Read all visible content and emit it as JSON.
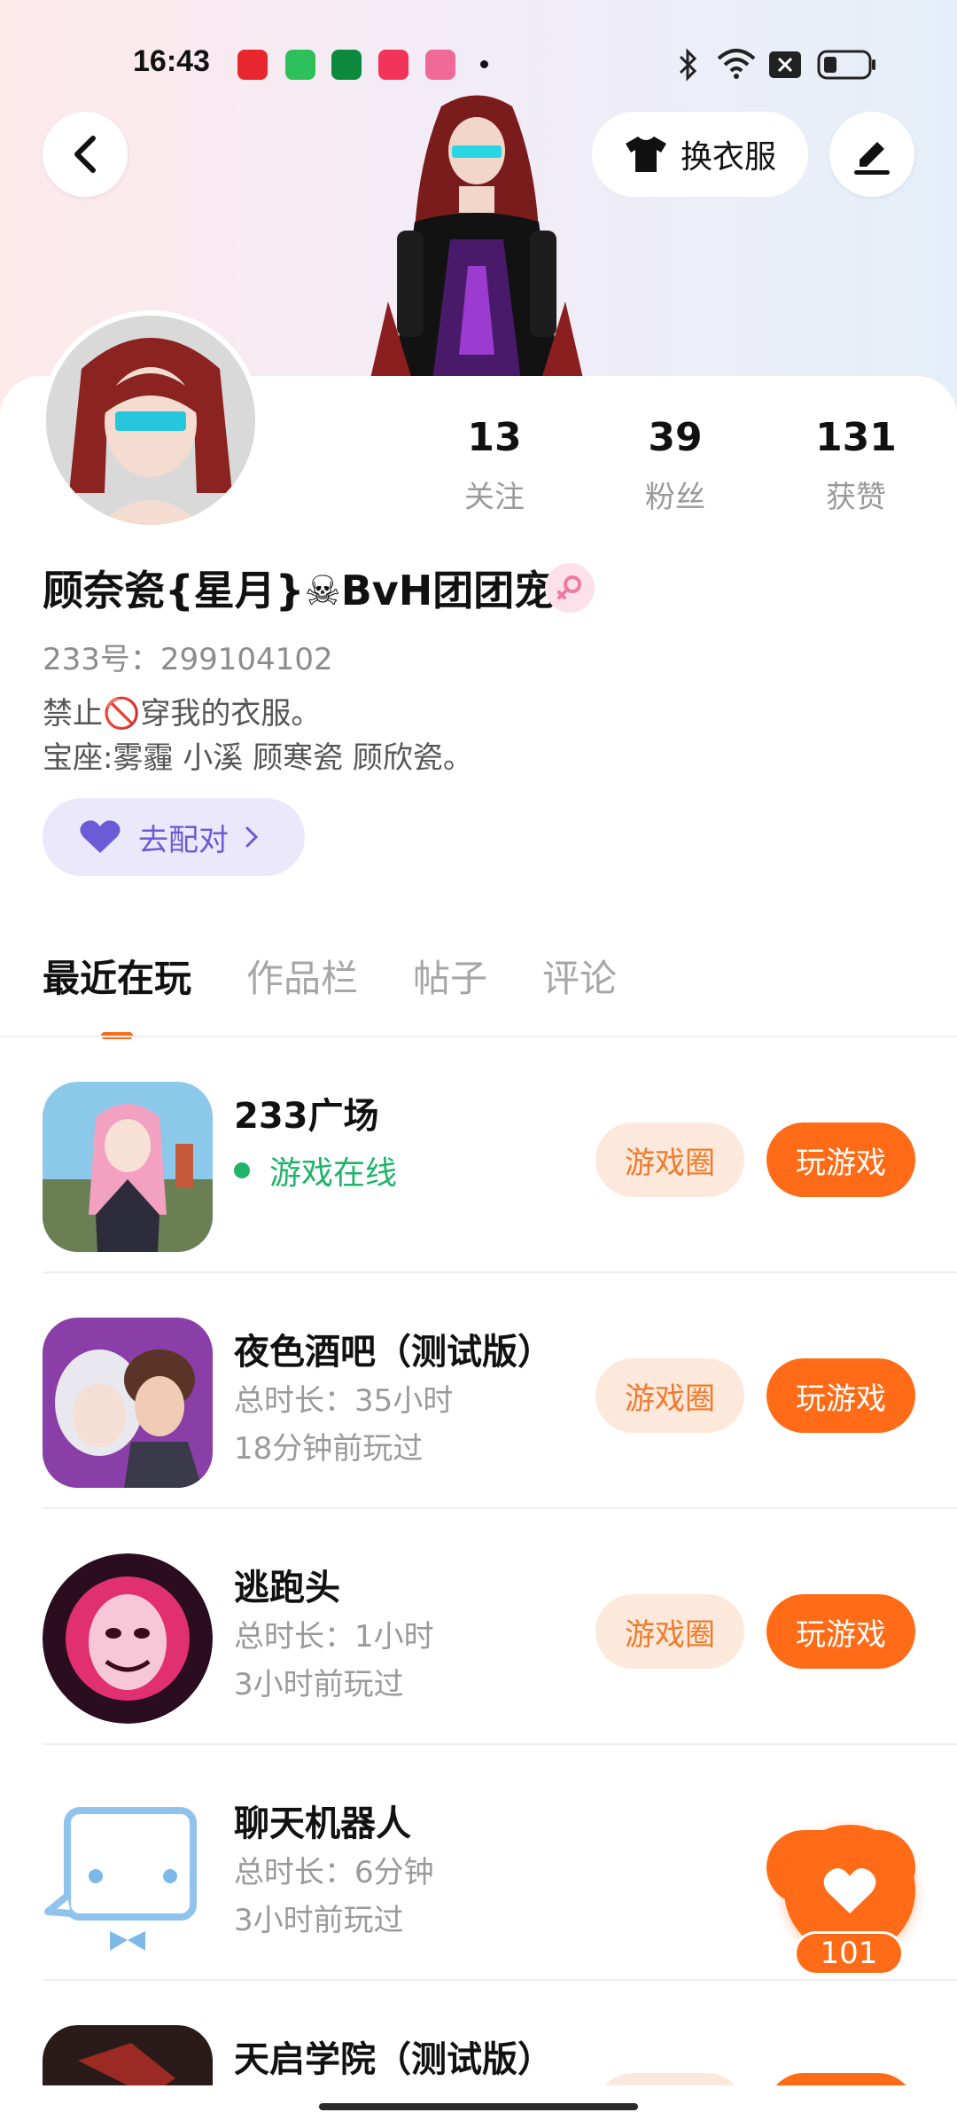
{
  "status_bar": {
    "time": "16:43"
  },
  "header": {
    "dress_label": "换衣服"
  },
  "profile": {
    "stats": [
      {
        "value": "13",
        "label": "关注"
      },
      {
        "value": "39",
        "label": "粉丝"
      },
      {
        "value": "131",
        "label": "获赞"
      }
    ],
    "name": "顾奈瓷{星月}☠BvH团团宠",
    "uid": "233号：299104102",
    "bio_line1": "禁止🚫穿我的衣服。",
    "bio_line2": "宝座:雾霾 小溪 顾寒瓷 顾欣瓷。",
    "match_label": "去配对"
  },
  "tabs": [
    "最近在玩",
    "作品栏",
    "帖子",
    "评论"
  ],
  "games": [
    {
      "name": "233广场",
      "status": "游戏在线"
    },
    {
      "name": "夜色酒吧（测试版）",
      "duration": "总时长：35小时",
      "last": "18分钟前玩过"
    },
    {
      "name": "逃跑头",
      "duration": "总时长：1小时",
      "last": "3小时前玩过"
    },
    {
      "name": "聊天机器人",
      "duration": "总时长：6分钟",
      "last": "3小时前玩过"
    },
    {
      "name": "天启学院（测试版）"
    }
  ],
  "buttons": {
    "circle": "游戏圈",
    "play": "玩游戏"
  },
  "fab": {
    "count": "101"
  },
  "colors": {
    "accent": "#ff6b17",
    "online": "#1fb36b",
    "match": "#6b5bd6"
  }
}
